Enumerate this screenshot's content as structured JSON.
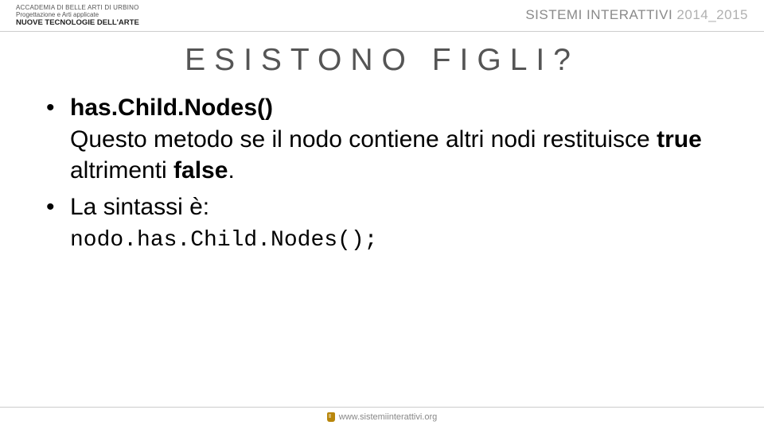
{
  "header": {
    "left_line1": "ACCADEMIA DI BELLE ARTI DI URBINO",
    "left_line2": "Progettazione e Arti applicate",
    "left_line3": "NUOVE TECNOLOGIE DELL'ARTE",
    "right_main": "SISTEMI INTERATTIVI ",
    "right_year": "2014_2015"
  },
  "slide": {
    "title": "ESISTONO FIGLI?",
    "bullets": [
      {
        "method": "has.Child.Nodes()",
        "desc_pre": "Questo metodo se il nodo contiene altri nodi restituisce ",
        "desc_true": "true",
        "desc_mid": " altrimenti ",
        "desc_false": "false",
        "desc_end": "."
      },
      {
        "intro": "La sintassi è:",
        "code": "nodo.has.Child.Nodes();"
      }
    ]
  },
  "footer": {
    "url": "www.sistemiinterattivi.org"
  }
}
